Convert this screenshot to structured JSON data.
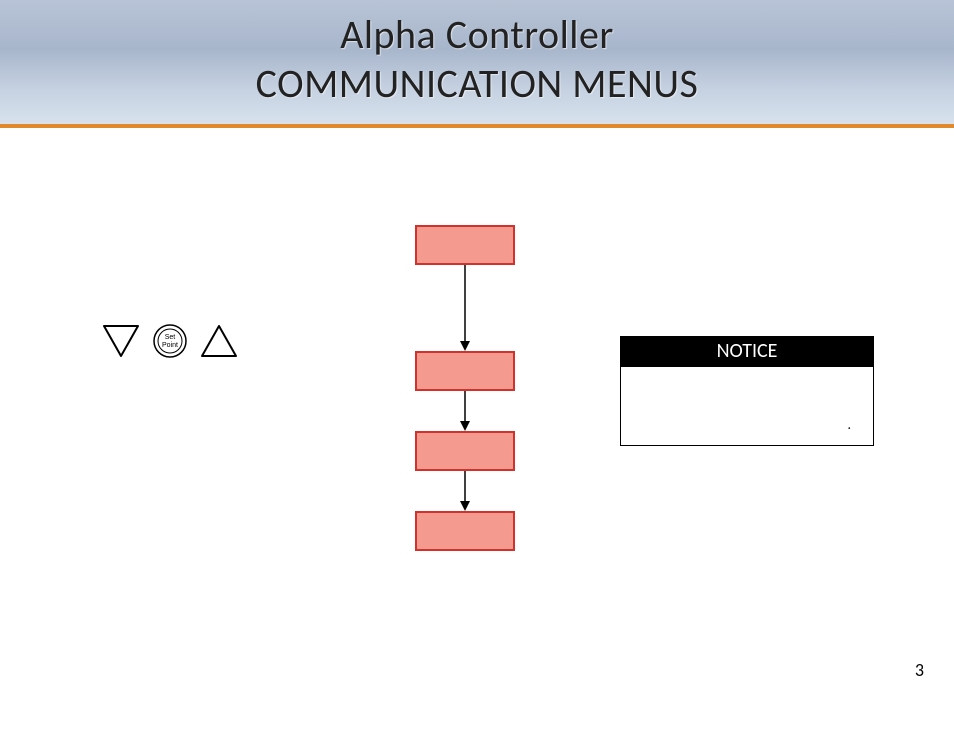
{
  "title": {
    "line1": "Alpha Controller",
    "line2": "COMMUNICATION MENUS"
  },
  "icons": {
    "down_triangle": "down-triangle-icon",
    "set_point_label_top": "Set",
    "set_point_label_bottom": "Point",
    "up_triangle": "up-triangle-icon"
  },
  "notice": {
    "heading": "NOTICE",
    "dot": "."
  },
  "page_number": "3"
}
